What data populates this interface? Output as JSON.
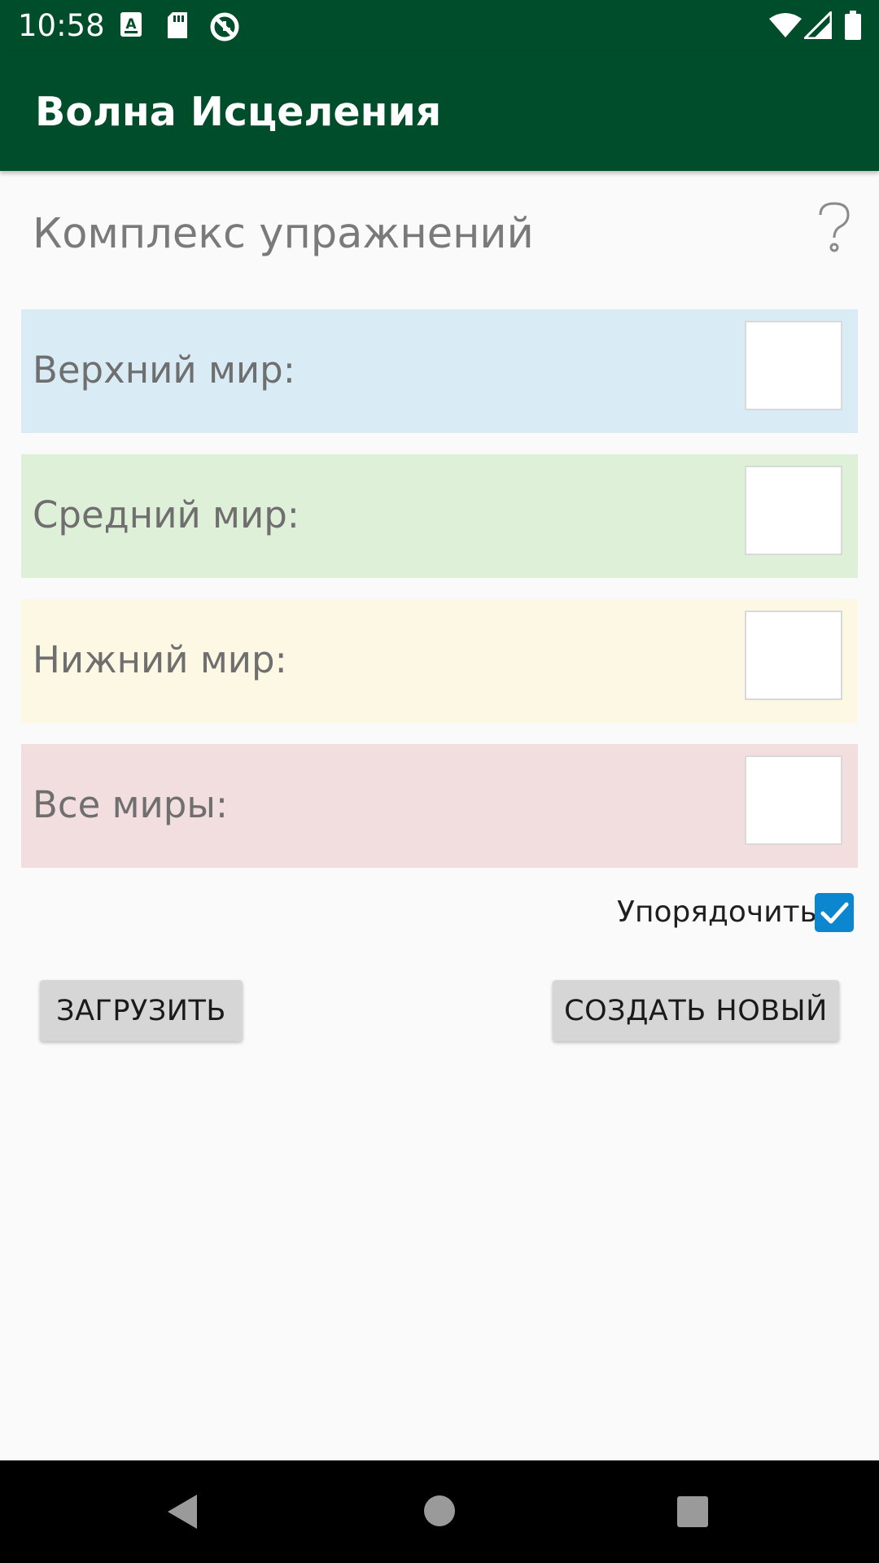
{
  "status_bar": {
    "time": "10:58",
    "icons": [
      "accessibility-a-icon",
      "sd-card-icon",
      "sync-circle-icon",
      "wifi-icon",
      "signal-icon",
      "battery-icon"
    ]
  },
  "app_bar": {
    "title": "Волна Исцеления",
    "color": "#004d2c"
  },
  "main": {
    "section_title": "Комплекс упражнений",
    "help_icon": "question-mark-icon",
    "worlds": [
      {
        "label": "Верхний мир:",
        "value": "",
        "color": "#d9ecf6"
      },
      {
        "label": "Средний мир:",
        "value": "",
        "color": "#dff0d9"
      },
      {
        "label": "Нижний мир:",
        "value": "",
        "color": "#fdf8e4"
      },
      {
        "label": "Все миры:",
        "value": "",
        "color": "#f2dede"
      }
    ],
    "sort": {
      "label": "Упорядочить",
      "checked": true
    },
    "buttons": {
      "load": "ЗАГРУЗИТЬ",
      "create": "СОЗДАТЬ НОВЫЙ"
    }
  },
  "nav_bar": {
    "icons": [
      "back-triangle-icon",
      "home-circle-icon",
      "recents-square-icon"
    ]
  }
}
